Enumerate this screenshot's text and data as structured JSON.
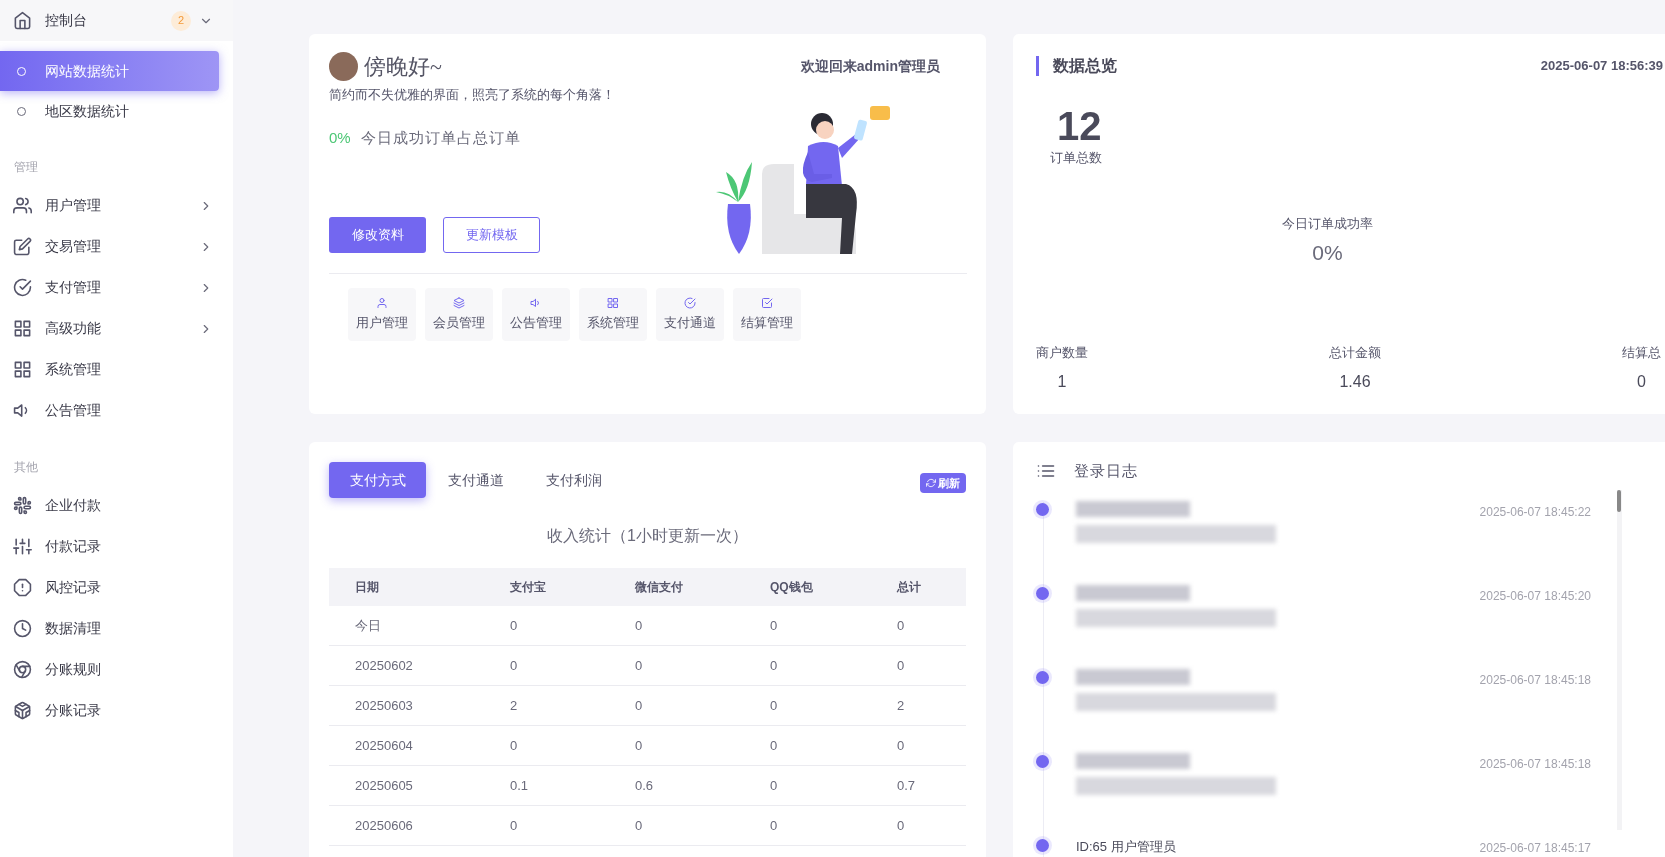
{
  "sidebar": {
    "groups": [
      {
        "items": [
          {
            "kind": "folder",
            "label": "控制台",
            "badge": "2",
            "expanded": true,
            "children": [
              {
                "label": "网站数据统计",
                "selected": true
              },
              {
                "label": "地区数据统计",
                "selected": false
              }
            ]
          }
        ]
      },
      {
        "title": "管理",
        "items": [
          {
            "kind": "folder",
            "label": "用户管理",
            "expanded": false
          },
          {
            "kind": "folder",
            "label": "交易管理",
            "expanded": false
          },
          {
            "kind": "folder",
            "label": "支付管理",
            "expanded": false
          },
          {
            "kind": "folder",
            "label": "高级功能",
            "expanded": false
          },
          {
            "kind": "link",
            "label": "系统管理"
          },
          {
            "kind": "link",
            "label": "公告管理"
          }
        ]
      },
      {
        "title": "其他",
        "items": [
          {
            "kind": "link",
            "label": "企业付款"
          },
          {
            "kind": "link",
            "label": "付款记录"
          },
          {
            "kind": "link",
            "label": "风控记录"
          },
          {
            "kind": "link",
            "label": "数据清理"
          },
          {
            "kind": "link",
            "label": "分账规则"
          },
          {
            "kind": "link",
            "label": "分账记录"
          }
        ]
      }
    ]
  },
  "welcome": {
    "greeting": "傍晚好~",
    "welcome_text": "欢迎回来admin管理员",
    "subtitle": "简约而不失优雅的界面，照亮了系统的每个角落！",
    "rate": "0%",
    "rate_label": "今日成功订单占总订单",
    "buttons": [
      {
        "label": "修改资料",
        "kind": "primary"
      },
      {
        "label": "更新模板",
        "kind": "outline"
      }
    ],
    "shortcuts": [
      "用户管理",
      "会员管理",
      "公告管理",
      "系统管理",
      "支付通道",
      "结算管理"
    ]
  },
  "overview": {
    "title": "数据总览",
    "time": "2025-06-07 18:56:39",
    "total": "12",
    "total_label": "订单总数",
    "rate_label": "今日订单成功率",
    "rate": "0%",
    "stats": [
      {
        "label": "商户数量",
        "value": "1"
      },
      {
        "label": "总计金额",
        "value": "1.46"
      },
      {
        "label": "结算总",
        "value": "0"
      }
    ]
  },
  "income": {
    "tabs": [
      {
        "label": "支付方式",
        "selected": true
      },
      {
        "label": "支付通道",
        "selected": false
      },
      {
        "label": "支付利润",
        "selected": false
      }
    ],
    "refresh": "刷新",
    "title": "收入统计（1小时更新一次）",
    "columns": [
      "日期",
      "支付宝",
      "微信支付",
      "QQ钱包",
      "总计"
    ],
    "rows": [
      [
        "今日",
        "0",
        "0",
        "0",
        "0"
      ],
      [
        "20250602",
        "0",
        "0",
        "0",
        "0"
      ],
      [
        "20250603",
        "2",
        "0",
        "0",
        "2"
      ],
      [
        "20250604",
        "0",
        "0",
        "0",
        "0"
      ],
      [
        "20250605",
        "0.1",
        "0.6",
        "0",
        "0.7"
      ],
      [
        "20250606",
        "0",
        "0",
        "0",
        "0"
      ]
    ]
  },
  "login_log": {
    "title": "登录日志",
    "entries": [
      {
        "kind": "blurred",
        "time": "2025-06-07 18:45:22"
      },
      {
        "kind": "blurred",
        "time": "2025-06-07 18:45:20"
      },
      {
        "kind": "blurred",
        "time": "2025-06-07 18:45:18"
      },
      {
        "kind": "blurred",
        "time": "2025-06-07 18:45:18"
      },
      {
        "kind": "text",
        "title": "ID:65 用户管理员",
        "time": "2025-06-07 18:45:17"
      }
    ]
  }
}
